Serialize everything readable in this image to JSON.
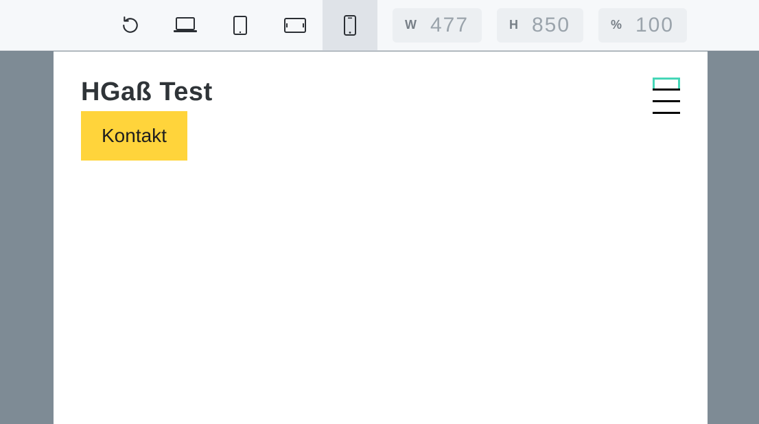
{
  "toolbar": {
    "width_label": "W",
    "width_value": "477",
    "height_label": "H",
    "height_value": "850",
    "zoom_label": "%",
    "zoom_value": "100"
  },
  "site": {
    "title": "HGaß Test",
    "cta_label": "Kontakt"
  }
}
